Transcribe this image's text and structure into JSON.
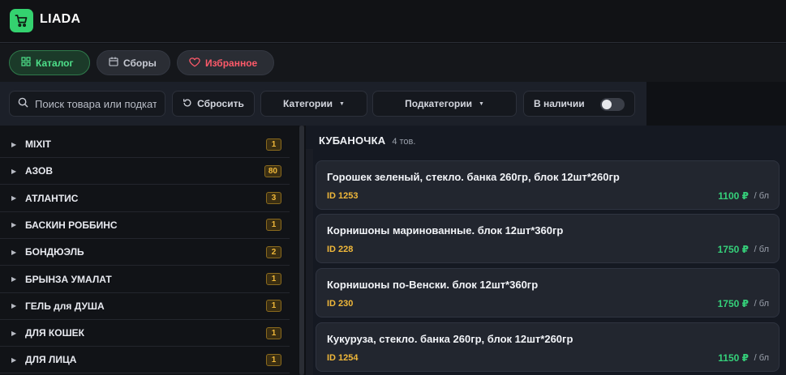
{
  "brand": {
    "name": "LIADA",
    "icon": "cart-icon",
    "color": "#34d26f"
  },
  "nav": {
    "catalog": {
      "label": "Каталог",
      "icon": "grid-icon",
      "color": "#4ee08a"
    },
    "sbory": {
      "label": "Сборы",
      "icon": "calendar-icon"
    },
    "favorites": {
      "label": "Избранное",
      "icon": "heart-icon",
      "color": "#ff5a6a"
    }
  },
  "filters": {
    "search_placeholder": "Поиск товара или подкатегории",
    "reset_label": "Сбросить",
    "categories_label": "Категории",
    "subcategories_label": "Подкатегории",
    "in_stock_label": "В наличии",
    "in_stock_on": false
  },
  "sidebar": {
    "items": [
      {
        "label": "MIXIT",
        "count": "1"
      },
      {
        "label": "АЗОВ",
        "count": "80"
      },
      {
        "label": "АТЛАНТИС",
        "count": "3"
      },
      {
        "label": "БАСКИН РОББИНС",
        "count": "1"
      },
      {
        "label": "БОНДЮЭЛЬ",
        "count": "2"
      },
      {
        "label": "БРЫНЗА УМАЛАТ",
        "count": "1"
      },
      {
        "label": "ГЕЛЬ для ДУША",
        "count": "1"
      },
      {
        "label": "ДЛЯ КОШЕК",
        "count": "1"
      },
      {
        "label": "ДЛЯ ЛИЦА",
        "count": "1"
      }
    ]
  },
  "main": {
    "title": "КУБАНОЧКА",
    "count": "4 тов.",
    "products": [
      {
        "name": "Горошек зеленый, стекло. банка 260гр, блок 12шт*260гр",
        "id": "ID 1253",
        "price": "1100 ₽",
        "unit": "/ бл"
      },
      {
        "name": "Корнишоны маринованные. блок 12шт*360гр",
        "id": "ID 228",
        "price": "1750 ₽",
        "unit": "/ бл"
      },
      {
        "name": "Корнишоны по-Венски. блок 12шт*360гр",
        "id": "ID 230",
        "price": "1750 ₽",
        "unit": "/ бл"
      },
      {
        "name": "Кукуруза, стекло. банка 260гр, блок 12шт*260гр",
        "id": "ID 1254",
        "price": "1150 ₽",
        "unit": "/ бл"
      }
    ]
  },
  "colors": {
    "accent": "#34d26f",
    "price": "#35d07a",
    "id": "#f0b83a",
    "badge": "#f0b83a"
  }
}
